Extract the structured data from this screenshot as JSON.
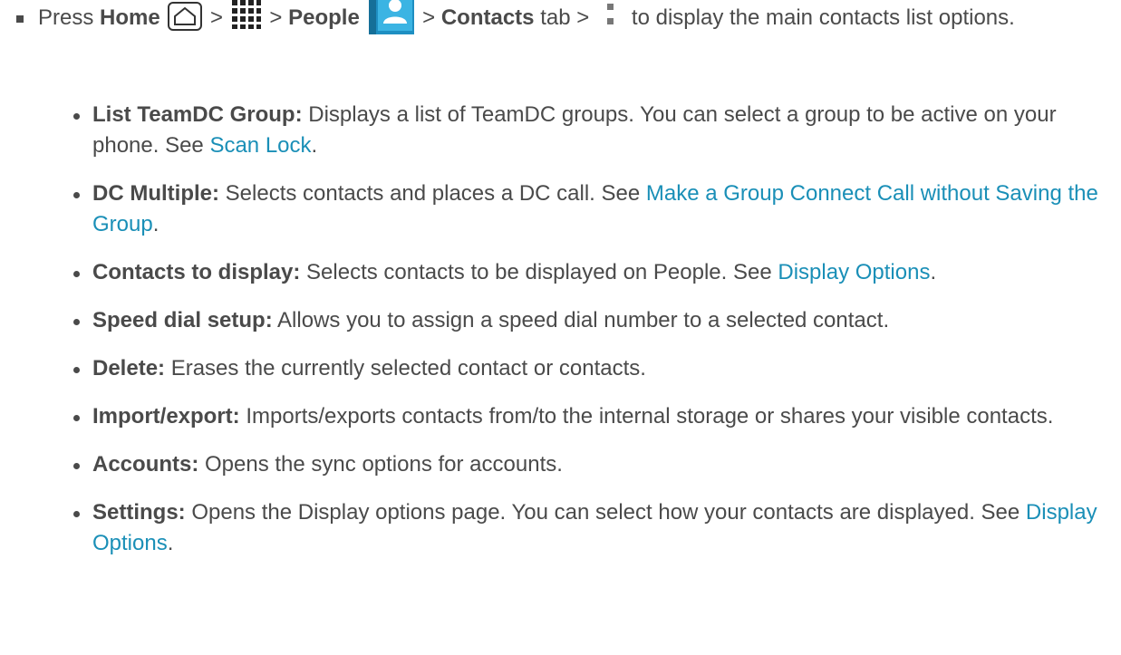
{
  "step": {
    "press": "Press",
    "home": "Home",
    "sep1": " > ",
    "sep2": " > ",
    "people": "People",
    "sep3": " > ",
    "contacts": "Contacts",
    "tab": " tab > ",
    "tail": "to display the main contacts list options."
  },
  "items": [
    {
      "label": "List TeamDC Group:",
      "text": " Displays a list of TeamDC groups. You can select a group to be active on your phone. See ",
      "link": "Scan Lock",
      "end": "."
    },
    {
      "label": "DC Multiple:",
      "text": " Selects contacts and places a DC call. See ",
      "link": "Make a Group Connect Call without Saving the Group",
      "end": "."
    },
    {
      "label": "Contacts to display:",
      "text": " Selects contacts to be displayed on People. See ",
      "link": "Display Options",
      "end": "."
    },
    {
      "label": "Speed dial setup:",
      "text": " Allows you to assign a speed dial number to a selected contact.",
      "link": "",
      "end": ""
    },
    {
      "label": "Delete:",
      "text": " Erases the currently selected contact or contacts.",
      "link": "",
      "end": ""
    },
    {
      "label": "Import/export:",
      "text": " Imports/exports contacts from/to the internal storage or shares your visible contacts.",
      "link": "",
      "end": ""
    },
    {
      "label": "Accounts:",
      "text": " Opens the sync options for accounts.",
      "link": "",
      "end": ""
    },
    {
      "label": "Settings:",
      "text": " Opens the Display options page. You can select how your contacts are displayed. See ",
      "link": "Display Options",
      "end": "."
    }
  ],
  "colors": {
    "text": "#4a4a4a",
    "link": "#1a8fb7",
    "people_icon": "#2aa6d8"
  }
}
